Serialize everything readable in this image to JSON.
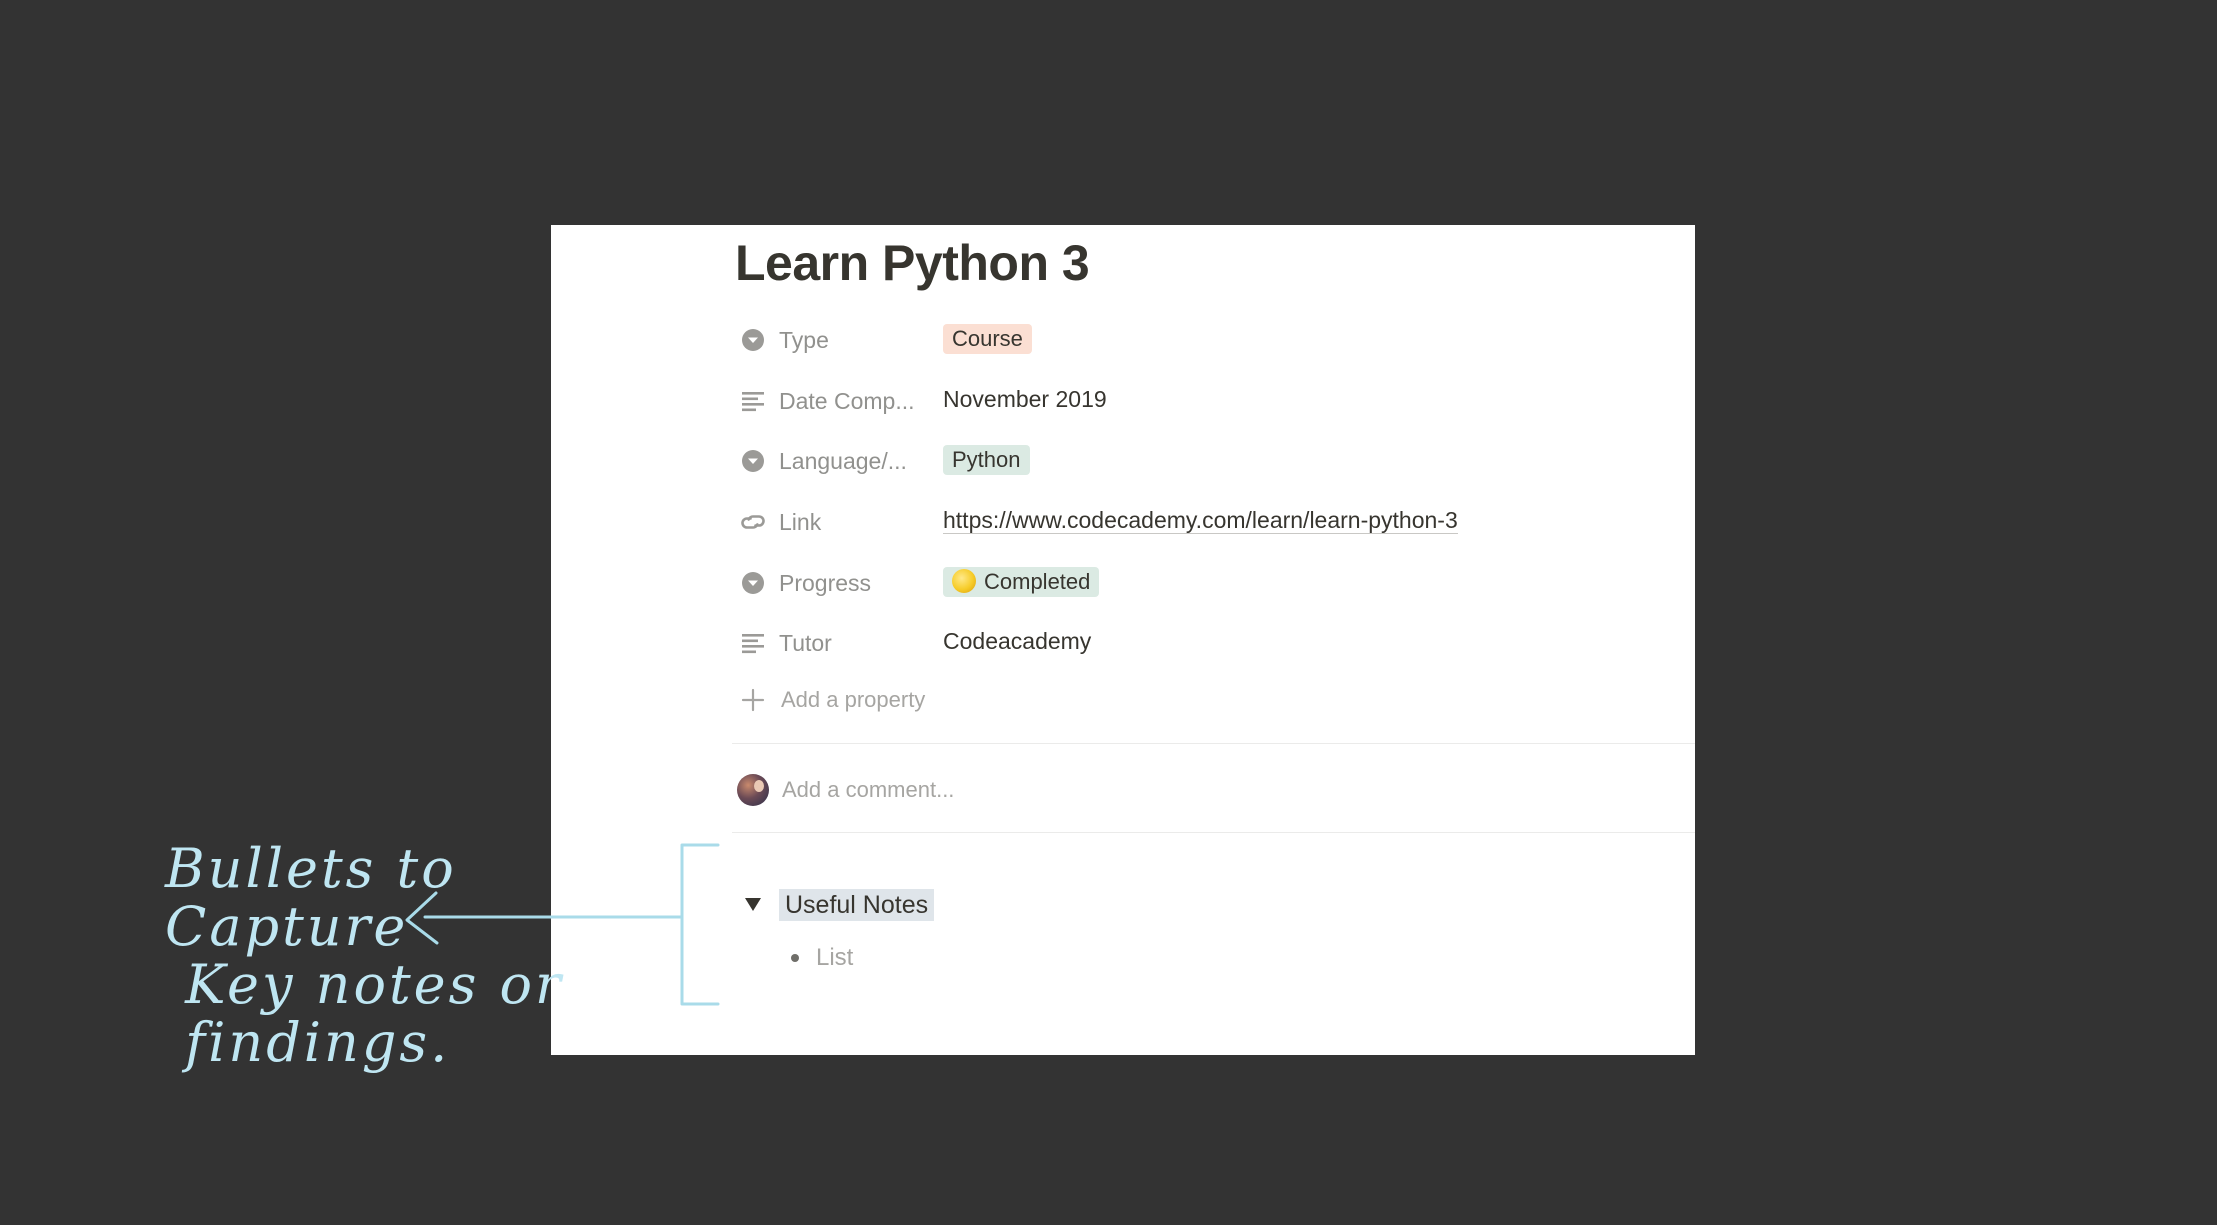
{
  "page": {
    "title": "Learn Python 3"
  },
  "properties": [
    {
      "icon": "select-icon",
      "name": "Type",
      "value": "Course",
      "kind": "tag",
      "tag_color": "#fbdfd3"
    },
    {
      "icon": "text-icon",
      "name": "Date Comp...",
      "value": "November 2019",
      "kind": "text"
    },
    {
      "icon": "select-icon",
      "name": "Language/...",
      "value": "Python",
      "kind": "tag",
      "tag_color": "#dbeae3"
    },
    {
      "icon": "link-icon",
      "name": "Link",
      "value": "https://www.codecademy.com/learn/learn-python-3",
      "kind": "url"
    },
    {
      "icon": "select-icon",
      "name": "Progress",
      "value": "Completed",
      "kind": "tag-with-emoji",
      "tag_color": "#dbeae3",
      "emoji": "yellow-circle-icon"
    },
    {
      "icon": "text-icon",
      "name": "Tutor",
      "value": "Codeacademy",
      "kind": "text"
    }
  ],
  "add_property": {
    "label": "Add a property"
  },
  "comment": {
    "placeholder": "Add a comment..."
  },
  "toggle": {
    "title": "Useful Notes",
    "highlight_color": "#dfe5ea",
    "items": [
      "List"
    ]
  },
  "annotation": {
    "text": "Bullets to\nCapture\n Key notes or\n findings.",
    "color": "#bfe6f2"
  },
  "colors": {
    "background": "#333333",
    "panel": "#ffffff",
    "text": "#37352f",
    "muted": "#91918e"
  }
}
